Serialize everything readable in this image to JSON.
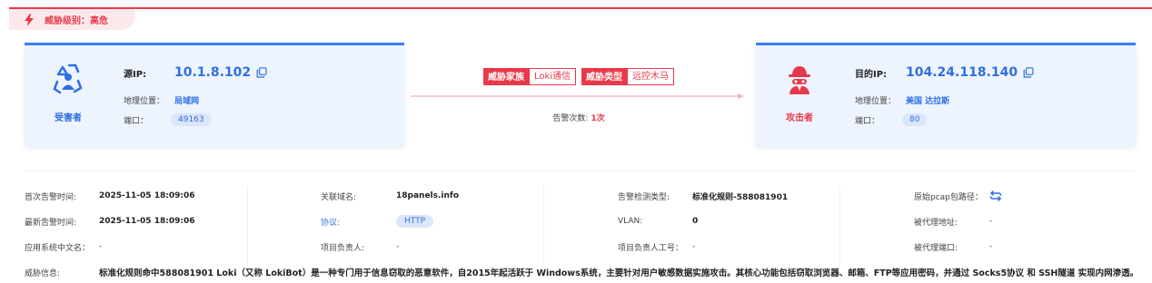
{
  "threat_level": {
    "text": "威胁级别：高危"
  },
  "victim": {
    "role": "受害者",
    "ip_label": "源IP:",
    "ip": "10.1.8.102",
    "geo_label": "地理位置：",
    "geo": "局域网",
    "port_label": "端口：",
    "port": "49163"
  },
  "attacker": {
    "role": "攻击者",
    "ip_label": "目的IP:",
    "ip": "104.24.118.140",
    "geo_label": "地理位置：",
    "geo": "美国 达拉斯",
    "port_label": "端口：",
    "port": "80"
  },
  "flow": {
    "family_label": "威胁家族",
    "family_value": "Loki通信",
    "type_label": "威胁类型",
    "type_value": "远控木马",
    "alert_count_label": "告警次数:",
    "alert_count_value": "1次"
  },
  "details": {
    "first_alert_label": "首次告警时间:",
    "first_alert": "2025-11-05 18:09:06",
    "domain_label": "关联域名:",
    "domain": "18panels.info",
    "detect_type_label": "告警检测类型:",
    "detect_type": "标准化规则-588081901",
    "pcap_label": "原始pcap包路径：",
    "last_alert_label": "最新告警时间:",
    "last_alert": "2025-11-05 18:09:06",
    "protocol_label": "协议:",
    "protocol": "HTTP",
    "vlan_label": "VLAN:",
    "vlan": "0",
    "proxied_addr_label": "被代理地址:",
    "proxied_addr": "-",
    "app_name_label": "应用系统中文名：",
    "app_name": "-",
    "owner_label": "项目负责人:",
    "owner": "-",
    "owner_id_label": "项目负责人工号：",
    "owner_id": "-",
    "proxied_port_label": "被代理端口:",
    "proxied_port": "-",
    "threat_info_label": "威胁信息:",
    "threat_info": "标准化规则命中588081901 Loki（又称 LokiBot）是一种专门用于信息窃取的恶意软件，自2015年起活跃于 Windows系统，主要针对用户敏感数据实施攻击。其核心功能包括窃取浏览器、邮箱、FTP等应用密码，并通过 Socks5协议 和 SSH隧道 实现内网渗透。"
  },
  "colors": {
    "danger": "#e8394a",
    "primary": "#2f6fe4",
    "card_bg": "#eef4fd"
  },
  "icons": [
    "lightning-icon",
    "victim-icon",
    "attacker-icon",
    "copy-icon",
    "arrow-icon",
    "pcap-path-icon"
  ]
}
